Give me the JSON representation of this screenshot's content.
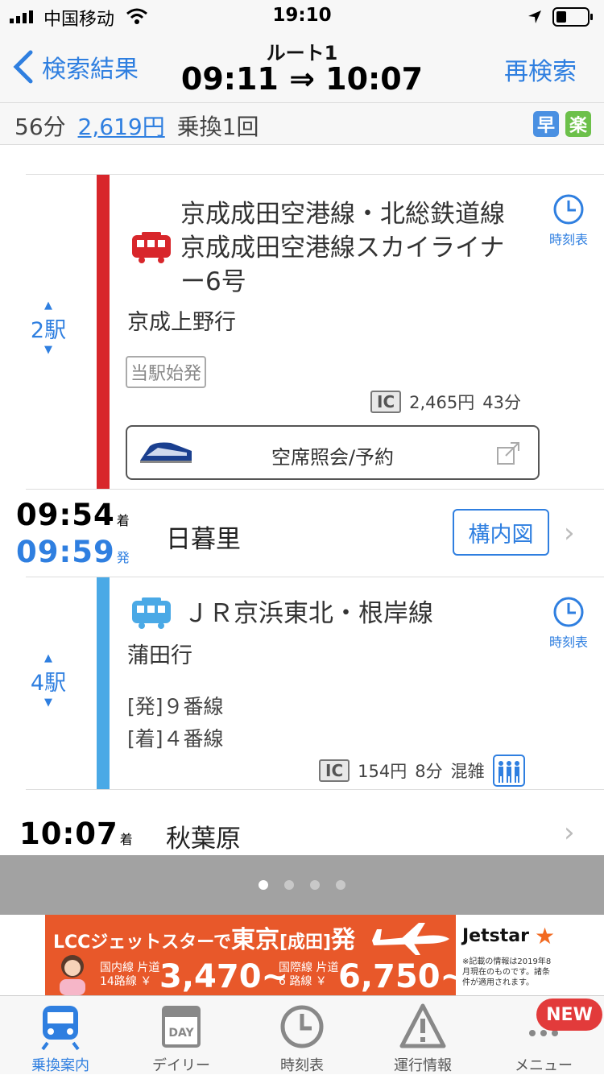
{
  "status_bar": {
    "carrier": "中国移动",
    "time": "19:10"
  },
  "nav": {
    "back_label": "検索結果",
    "route_title": "ルート1",
    "route_times": "09:11 ⇒ 10:07",
    "research_label": "再検索"
  },
  "summary": {
    "duration": "56分",
    "fare": "2,619円",
    "transfers": "乗換1回",
    "badge_fast": "早",
    "badge_easy": "楽"
  },
  "segments": [
    {
      "stations": "2駅",
      "line_name_1": "京成成田空港線・北総鉄道線",
      "line_name_2": "京成成田空港線スカイライナ",
      "line_name_3": "ー6号",
      "destination": "京成上野行",
      "tag": "当駅始発",
      "timetable_label": "時刻表",
      "ic_label": "IC",
      "fare": "2,465円",
      "duration": "43分",
      "reserve_label": "空席照会/予約",
      "line_color": "#d8262b"
    },
    {
      "stations": "4駅",
      "line_name": "ＪＲ京浜東北・根岸線",
      "destination": "蒲田行",
      "departure_platform": "[発]９番線",
      "arrival_platform": "[着]４番線",
      "timetable_label": "時刻表",
      "ic_label": "IC",
      "fare": "154円",
      "duration": "8分",
      "crowding": "混雑",
      "line_color": "#4aa9e6"
    }
  ],
  "transfer": {
    "arrive_time": "09:54",
    "arrive_mark": "着",
    "depart_time": "09:59",
    "depart_mark": "発",
    "station": "日暮里",
    "map_label": "構内図"
  },
  "destination": {
    "time": "10:07",
    "mark": "着",
    "station": "秋葉原"
  },
  "ad": {
    "headline_prefix": "LCCジェットスターで",
    "headline_city": "東京",
    "headline_sub": "[成田]",
    "headline_suffix": "発",
    "domestic_label_1": "国内線 片道",
    "domestic_label_2": "14路線 ￥",
    "domestic_price": "3,470~",
    "intl_label_1": "国際線 片道",
    "intl_label_2": "6 路線 ￥",
    "intl_price": "6,750~",
    "brand": "Jetstar",
    "note": "※記載の情報は2019年8月現在のものです。諸条件が適用されます。"
  },
  "tabs": [
    "乗換案内",
    "デイリー",
    "時刻表",
    "運行情報",
    "メニュー"
  ],
  "new_badge": "NEW",
  "colors": {
    "accent": "#2f7fe0",
    "red_line": "#d8262b",
    "blue_line": "#4aa9e6",
    "badge_fast": "#4a90e2",
    "badge_easy": "#6cc04a"
  }
}
